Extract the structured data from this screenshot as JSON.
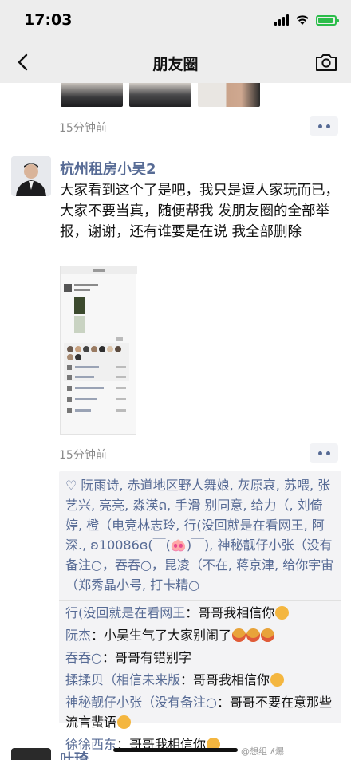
{
  "status": {
    "time": "17:03"
  },
  "nav": {
    "title": "朋友圈"
  },
  "prev_post": {
    "time": "15分钟前"
  },
  "post": {
    "author": "杭州租房小吴2",
    "text": "大家看到这个了是吧，我只是逗人家玩而已，大家不要当真，随便帮我 发朋友圈的全部举报，谢谢，还有谁要是在说 我全部删除",
    "time": "15分钟前",
    "likes": "♡ 阮雨诗, 赤道地区野人舞娘, 灰原哀, 苏喂, 张艺兴, 亮亮, 淼渶ດ, 手滑 别同意, 给力（, 刘倚婷, 橙（电竞林志玲, 行(没回就是在看网王, 阿深., ʚ10086ɞ(￣(🐽)￣), 神秘靓仔小张（没有备注○，吞吞○，昆凌（不在, 蒋京津, 给你宇宙（郑秀晶小号, 打卡精○",
    "comments": [
      {
        "name": "行(没回就是在看网王",
        "text": "：哥哥我相信你"
      },
      {
        "name": "阮杰",
        "text": "：小吴生气了大家别闹了"
      },
      {
        "name": "吞吞○",
        "text": "：哥哥有错别字"
      },
      {
        "name": "揉揉贝（相信未来版",
        "text": "：哥哥我相信你"
      },
      {
        "name": "神秘靓仔小张（没有备注○",
        "text": "：哥哥不要在意那些流言蜚语"
      },
      {
        "name": "徐徐西东",
        "text": "：哥哥我相信你"
      }
    ]
  },
  "next_post": {
    "author": "叶琦"
  },
  "watermark": "@想组 ʎ爆",
  "colors": {
    "link": "#576b95",
    "nav_bg": "#ededed",
    "likes_bg": "#f3f3f5"
  }
}
